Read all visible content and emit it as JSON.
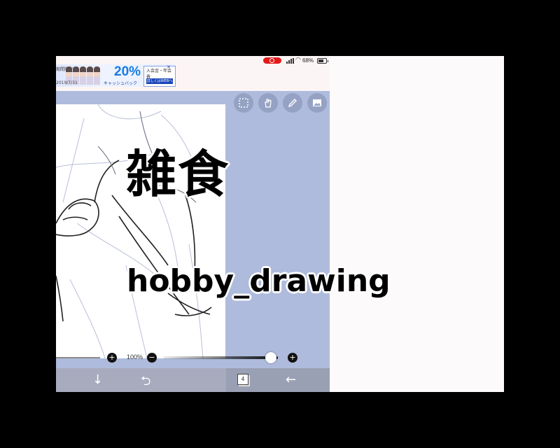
{
  "status_bar": {
    "battery_pct": "68%",
    "recording_icon": "screen-record-icon",
    "signal_icon": "cellular-signal-icon",
    "wifi_icon": "wifi-icon",
    "battery_icon": "battery-icon"
  },
  "ad_banner": {
    "text_top": "期間限定",
    "text_bottom": "2019/7/31",
    "percent": "20%",
    "cashback": "キャッシュバック",
    "box_text": "入会金・年会費",
    "cta": "詳しくはWEBへ",
    "close_icon": "close-icon"
  },
  "top_tools": [
    {
      "name": "selection-tool-button",
      "icon": "marquee-select-icon"
    },
    {
      "name": "hand-tool-button",
      "icon": "hand-icon"
    },
    {
      "name": "pen-tool-button",
      "icon": "pencil-icon"
    },
    {
      "name": "gallery-button",
      "icon": "image-icon"
    }
  ],
  "zoom": {
    "value": "100%",
    "minus": "−",
    "plus": "+",
    "opacity_level": 0.94
  },
  "bottom_bar": {
    "layer_count": "4",
    "down_icon": "arrow-down-icon",
    "undo_icon": "undo-icon",
    "back_icon": "arrow-left-icon",
    "layers_icon": "layers-icon"
  },
  "overlay": {
    "title_jp": "雑食",
    "title_en": "hobby_drawing"
  },
  "colors": {
    "workspace": "#aebbdc",
    "record": "#e41a1a",
    "ad_accent": "#1a7be0"
  }
}
